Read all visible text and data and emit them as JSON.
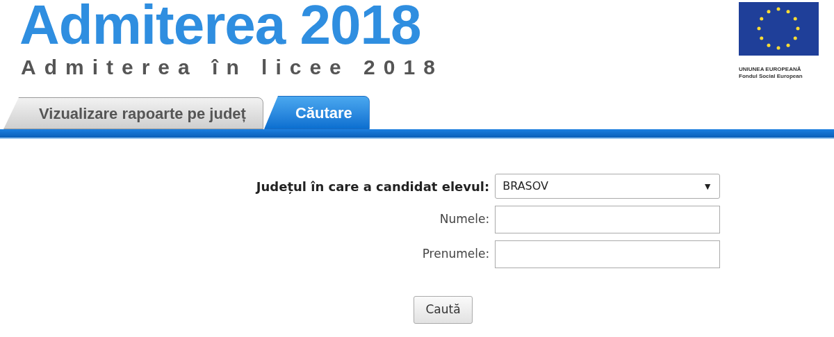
{
  "header": {
    "title": "Admiterea 2018",
    "subtitle": "Admiterea în licee 2018",
    "logo_caption": [
      "UNIUNEA EUROPEANĂ",
      "Fondul Social European"
    ]
  },
  "tabs": [
    {
      "label": "Vizualizare rapoarte pe județ",
      "selected": false
    },
    {
      "label": "Căutare",
      "selected": true
    }
  ],
  "form": {
    "fields": [
      {
        "kind": "select",
        "label": "Județul în care a candidat elevul:",
        "value": "BRASOV",
        "caret": "▼"
      },
      {
        "kind": "text",
        "label": "Numele:"
      },
      {
        "kind": "text",
        "label": "Prenumele:"
      }
    ],
    "button": "Caută"
  }
}
